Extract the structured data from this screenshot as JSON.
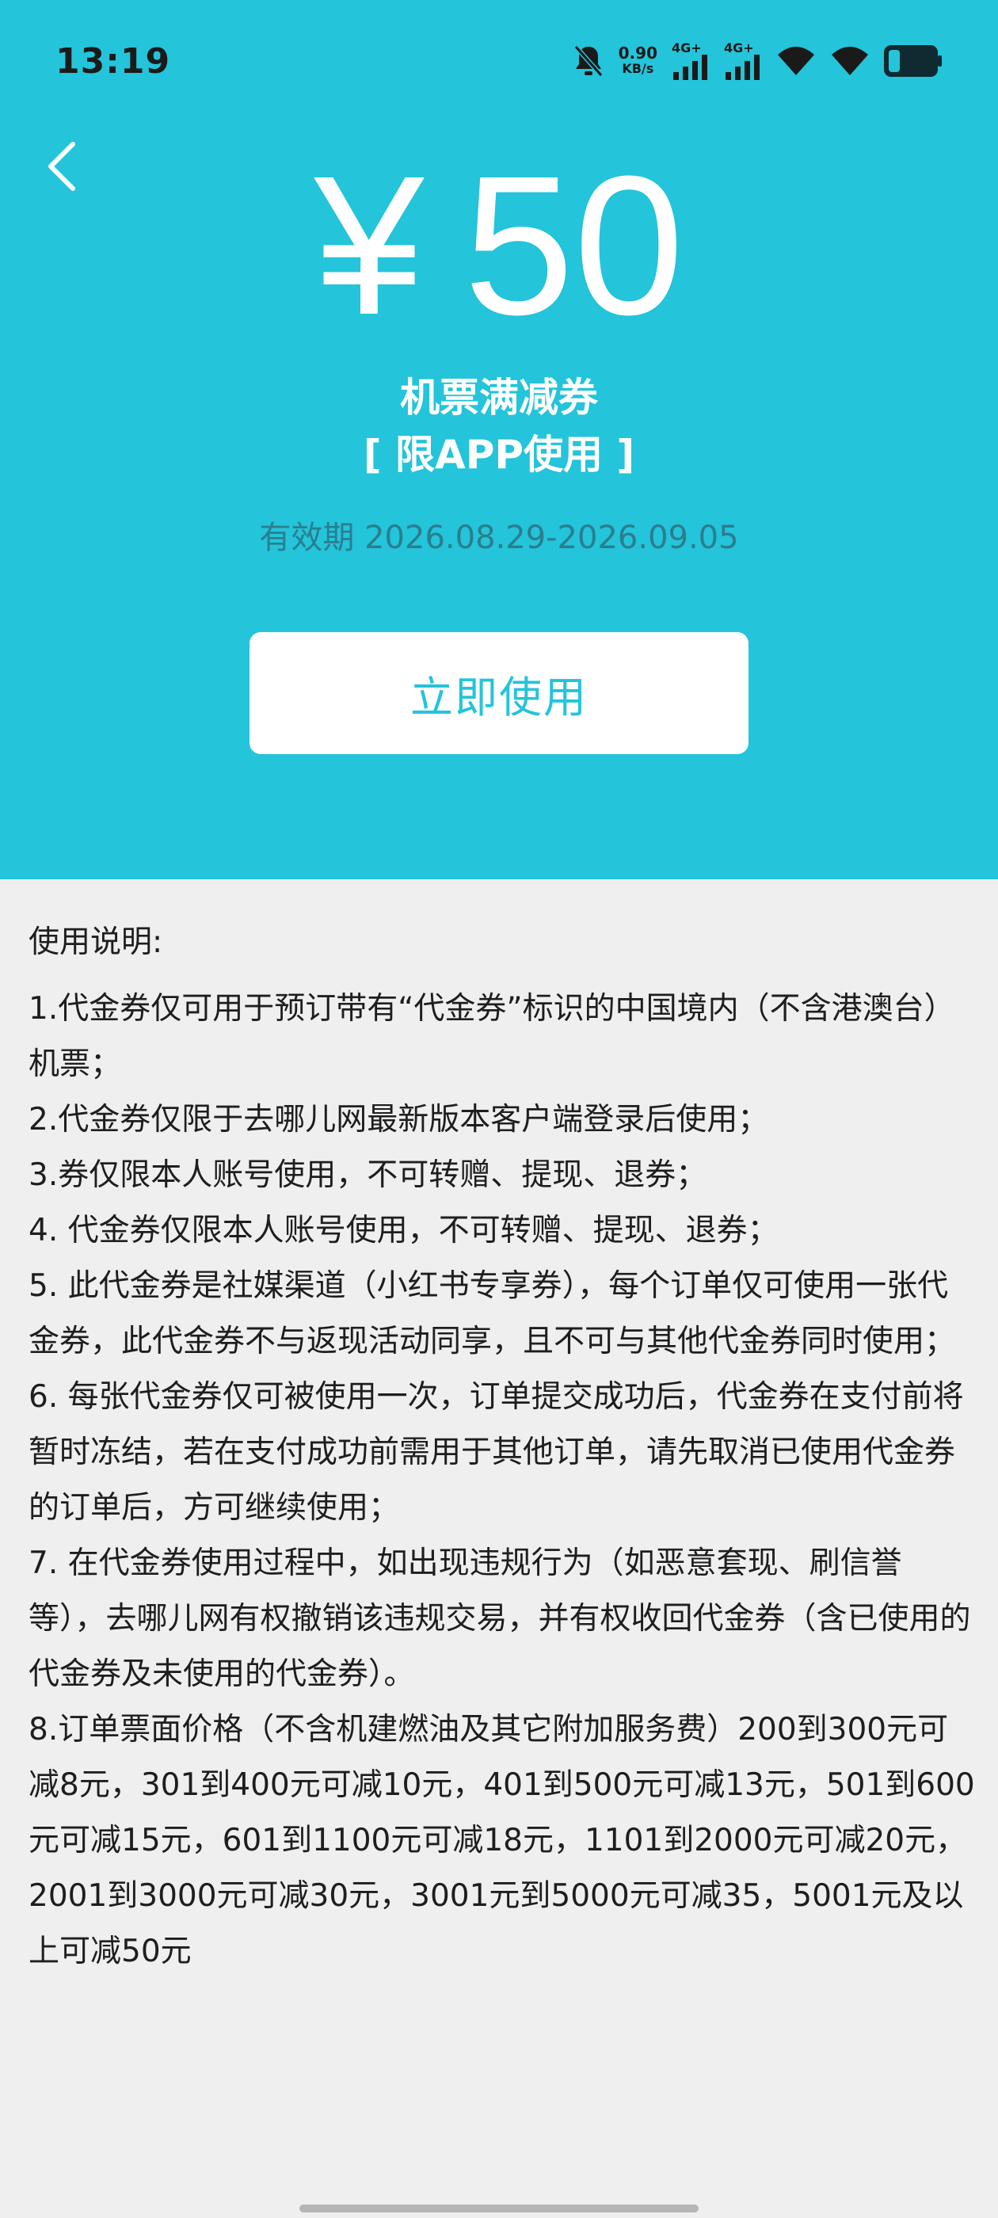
{
  "status_bar": {
    "time": "13:19",
    "net_speed_value": "0.90",
    "net_speed_unit": "KB/s",
    "signal1_label": "4G+",
    "signal2_label": "4G+",
    "icons": [
      "bell-off-icon",
      "signal-icon",
      "signal-icon",
      "wifi-icon",
      "wifi-icon",
      "battery-icon"
    ]
  },
  "nav": {
    "back_icon": "chevron-left-icon"
  },
  "coupon": {
    "currency": "¥",
    "amount": "50",
    "name": "机票满减券",
    "limit": "[ 限APP使用 ]",
    "validity": "有效期 2026.08.29-2026.09.05",
    "use_button": "立即使用"
  },
  "instructions": {
    "title": "使用说明:",
    "items": [
      "1.代金券仅可用于预订带有“代金券”标识的中国境内（不含港澳台）机票；",
      "2.代金券仅限于去哪儿网最新版本客户端登录后使用；",
      "3.券仅限本人账号使用，不可转赠、提现、退券；",
      "4. 代金券仅限本人账号使用，不可转赠、提现、退券；",
      "5. 此代金券是社媒渠道（小红书专享券），每个订单仅可使用一张代金券，此代金券不与返现活动同享，且不可与其他代金券同时使用；",
      "6. 每张代金券仅可被使用一次，订单提交成功后，代金券在支付前将暂时冻结，若在支付成功前需用于其他订单，请先取消已使用代金券的订单后，方可继续使用；",
      "7. 在代金券使用过程中，如出现违规行为（如恶意套现、刷信誉等），去哪儿网有权撤销该违规交易，并有权收回代金券（含已使用的代金券及未使用的代金券）。",
      "8.订单票面价格（不含机建燃油及其它附加服务费）200到300元可减8元，301到400元可减10元，401到500元可减13元，501到600元可减15元，601到1100元可减18元，1101到2000元可减20元，2001到3000元可减30元，3001元到5000元可减35，5001元及以上可减50元"
    ]
  },
  "colors": {
    "hero_bg": "#24c4da",
    "page_bg": "#efefef",
    "validity_text": "#2a7e8e",
    "button_text": "#24c4da"
  }
}
